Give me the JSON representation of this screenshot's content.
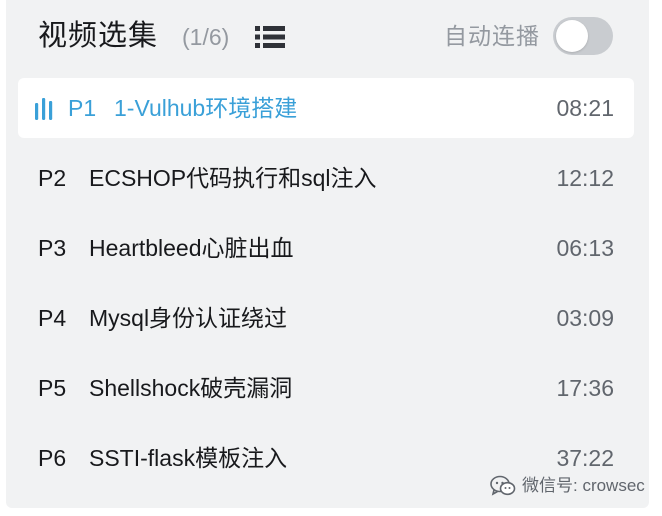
{
  "header": {
    "title": "视频选集",
    "count": "(1/6)",
    "list_icon": "list-view-icon",
    "autoplay_label": "自动连播",
    "autoplay_on": false
  },
  "episodes": [
    {
      "part": "P1",
      "title": "1-Vulhub环境搭建",
      "duration": "08:21",
      "active": true
    },
    {
      "part": "P2",
      "title": "ECSHOP代码执行和sql注入",
      "duration": "12:12",
      "active": false
    },
    {
      "part": "P3",
      "title": "Heartbleed心脏出血",
      "duration": "06:13",
      "active": false
    },
    {
      "part": "P4",
      "title": "Mysql身份认证绕过",
      "duration": "03:09",
      "active": false
    },
    {
      "part": "P5",
      "title": "Shellshock破壳漏洞",
      "duration": "17:36",
      "active": false
    },
    {
      "part": "P6",
      "title": "SSTI-flask模板注入",
      "duration": "37:22",
      "active": false
    }
  ],
  "watermark": {
    "icon": "wechat-icon",
    "text": "微信号: crowsec"
  },
  "colors": {
    "accent": "#3aa0d8",
    "panel_bg": "#f1f2f3",
    "toggle_off": "#c9ccd0"
  }
}
